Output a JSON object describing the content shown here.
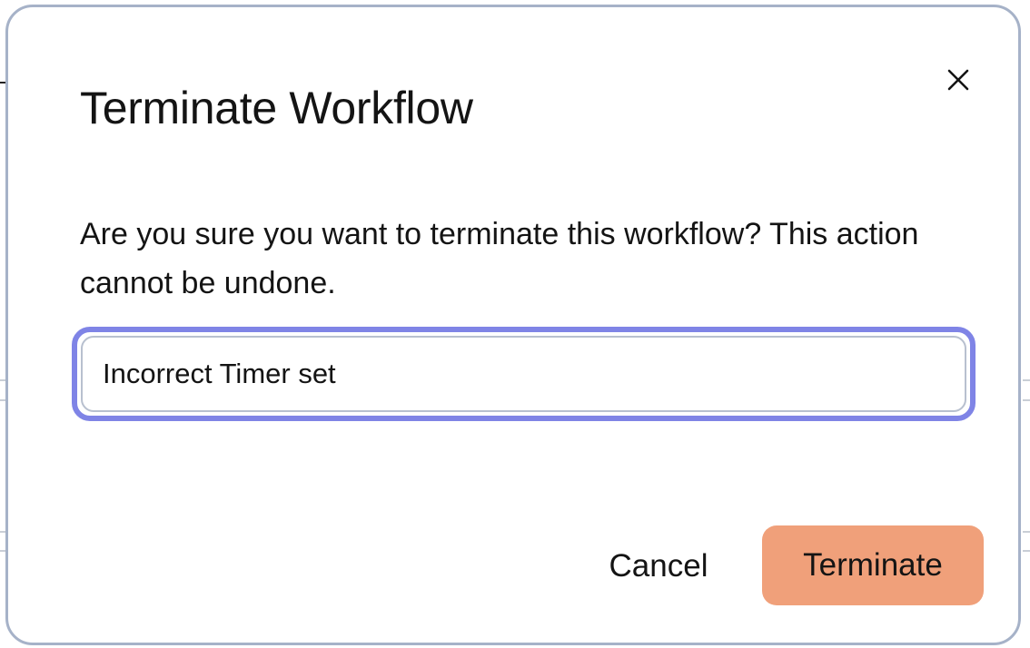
{
  "dialog": {
    "title": "Terminate Workflow",
    "message": "Are you sure you want to terminate this workflow? This action cannot be undone.",
    "close_icon": "close-icon"
  },
  "reason_input": {
    "value": "Incorrect Timer set",
    "focused": true
  },
  "actions": {
    "cancel_label": "Cancel",
    "terminate_label": "Terminate"
  },
  "colors": {
    "focus_ring": "#7f84e6",
    "terminate_bg": "#f0a07a",
    "modal_border": "#a6b2c8",
    "text": "#141414"
  }
}
